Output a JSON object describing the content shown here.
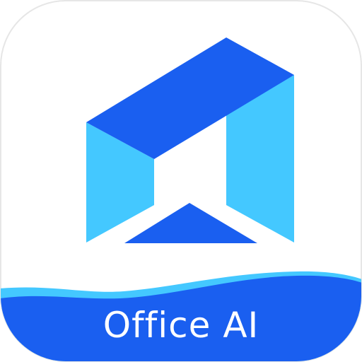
{
  "app": {
    "name": "Office AI"
  },
  "colors": {
    "tile_background": "#ffffff",
    "tile_border": "#e6e6e6",
    "logo_dark_blue": "#1a5ff0",
    "logo_light_blue": "#44c8ff",
    "wave_light_blue": "#44c8ff",
    "banner_blue": "#1a5ff0",
    "label_text": "#ffffff"
  },
  "icons": {
    "logo": "office-ai-logo-icon"
  }
}
